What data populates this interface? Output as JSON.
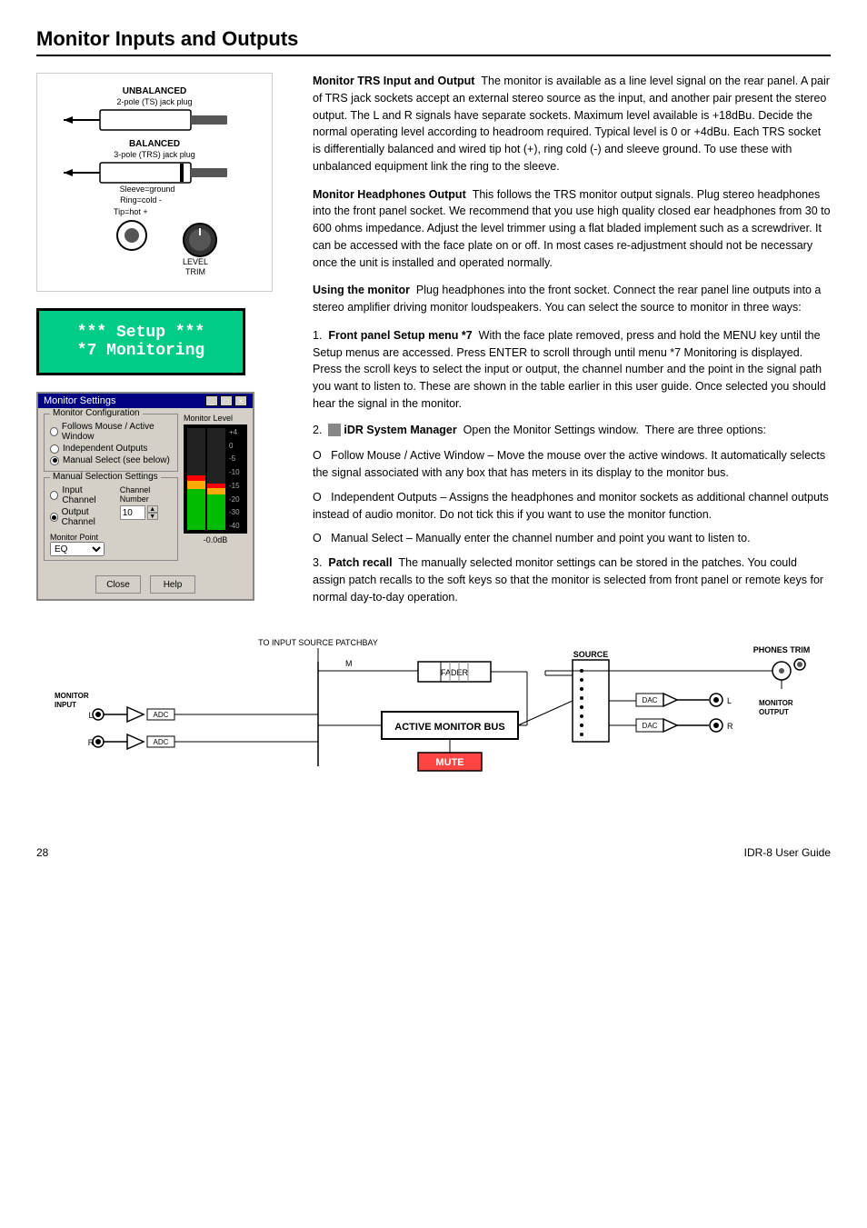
{
  "page": {
    "title": "Monitor Inputs and Outputs",
    "page_number": "28",
    "product": "IDR-8 User Guide"
  },
  "trs_section": {
    "labels": {
      "unbalanced": "UNBALANCED",
      "unbalanced_sub": "2-pole (TS) jack plug",
      "balanced": "BALANCED",
      "balanced_sub": "3-pole (TRS) jack plug",
      "sleeve": "Sleeve=ground",
      "ring": "Ring=cold -",
      "tip": "Tip=hot +"
    },
    "level_trim_label": "LEVEL TRIM"
  },
  "monitor_trs": {
    "title": "Monitor TRS Input and Output",
    "body": "The monitor is available as a line level signal on the rear panel. A pair of TRS jack sockets accept an external stereo source as the input, and another pair present the stereo output. The L and R signals have separate sockets. Maximum level available is +18dBu. Decide the normal operating level according to headroom required. Typical level is 0 or +4dBu. Each TRS socket is differentially balanced and wired tip hot (+), ring cold (-) and sleeve ground. To use these with unbalanced equipment link the ring to the sleeve."
  },
  "monitor_headphones": {
    "title": "Monitor Headphones Output",
    "body": "This follows the TRS monitor output signals. Plug stereo headphones into the front panel socket. We recommend that you use high quality closed ear headphones from 30 to 600 ohms impedance. Adjust the level trimmer using a flat bladed implement such as a screwdriver. It can be accessed with the face plate on or off. In most cases re-adjustment should not be necessary once the unit is installed and operated normally."
  },
  "using_monitor": {
    "title": "Using the monitor",
    "intro": "Plug headphones into the front socket. Connect the rear panel line outputs into a stereo amplifier driving monitor loudspeakers. You can select the source to monitor in three ways:",
    "items": [
      {
        "num": "1.",
        "label": "Front panel Setup menu *7",
        "body": "With the face plate removed, press and hold the MENU key until the Setup menus are accessed. Press ENTER to scroll through until menu *7 Monitoring is displayed. Press the scroll keys to select the input or output, the channel number and the point in the signal path you want to listen to. These are shown in the table earlier in this user guide. Once selected you should hear the signal in the monitor."
      },
      {
        "num": "2.",
        "label": "iDR System Manager",
        "body": "Open the Monitor Settings window. There are three options:"
      }
    ],
    "options": [
      "O   Follow Mouse / Active Window – Move the mouse over the active windows. It automatically selects the signal associated with any box that has meters in its display to the monitor bus.",
      "O   Independent Outputs – Assigns the headphones and monitor sockets as additional channel outputs instead of audio monitor. Do not tick this if you want to use the monitor function.",
      "O   Manual Select – Manually enter the channel number and point you want to listen to."
    ],
    "patch_recall": {
      "num": "3.",
      "label": "Patch recall",
      "body": "The manually selected monitor settings can be stored in the patches. You could assign patch recalls to the soft keys so that the monitor is selected from front panel or remote keys for normal day-to-day operation."
    }
  },
  "setup_box": {
    "line1": "*** Setup ***",
    "line2": "*7 Monitoring"
  },
  "monitor_settings_win": {
    "title": "Monitor Settings",
    "config_group": "Monitor Configuration",
    "config_options": [
      {
        "label": "Follows Mouse / Active Window",
        "checked": false
      },
      {
        "label": "Independent Outputs",
        "checked": false
      },
      {
        "label": "Manual Select (see below)",
        "checked": true
      }
    ],
    "manual_group": "Manual Selection Settings",
    "manual_options": [
      {
        "label": "Input Channel",
        "checked": false
      },
      {
        "label": "Output Channel",
        "checked": true
      }
    ],
    "channel_number_label": "Channel Number",
    "channel_value": "10",
    "monitor_point_label": "Monitor Point",
    "monitor_point_value": "EQ",
    "level_label": "Monitor Level",
    "db_label": "-0.0dB",
    "buttons": {
      "close": "Close",
      "help": "Help"
    }
  },
  "signal_diagram": {
    "labels": {
      "to_input": "TO INPUT SOURCE PATCHBAY",
      "monitor_input": "MONITOR INPUT",
      "l": "L",
      "r": "R",
      "adc": "ADC",
      "m": "M",
      "fader": "FADER",
      "active_monitor_bus": "ACTIVE MONITOR BUS",
      "mute": "MUTE",
      "source": "SOURCE",
      "dac": "DAC",
      "monitor_output": "MONITOR OUTPUT",
      "phones_trim": "PHONES TRIM",
      "l_out": "L",
      "r_out": "R"
    }
  }
}
